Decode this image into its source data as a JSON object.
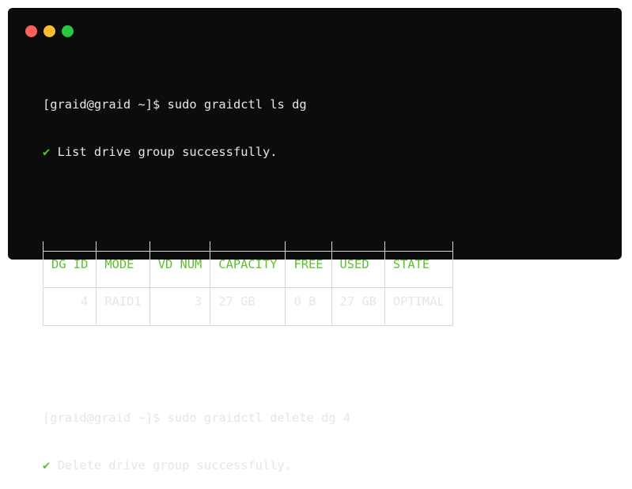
{
  "window": {
    "dots": [
      "#fe5f57",
      "#febc2e",
      "#28c840"
    ]
  },
  "terminal": {
    "prompt": "[graid@graid ~]$",
    "command1": "sudo graidctl ls dg",
    "check_icon": "✔",
    "msg1": "List drive group successfully.",
    "command2": "sudo graidctl delete dg 4",
    "msg2": "Delete drive group successfully."
  },
  "table": {
    "headers": [
      "DG ID",
      "MODE",
      "VD NUM",
      "CAPACITY",
      "FREE",
      "USED",
      "STATE"
    ],
    "rows": [
      [
        "4",
        "RAID1",
        "3",
        "27 GB",
        "0 B",
        "27 GB",
        "OPTIMAL"
      ]
    ]
  }
}
